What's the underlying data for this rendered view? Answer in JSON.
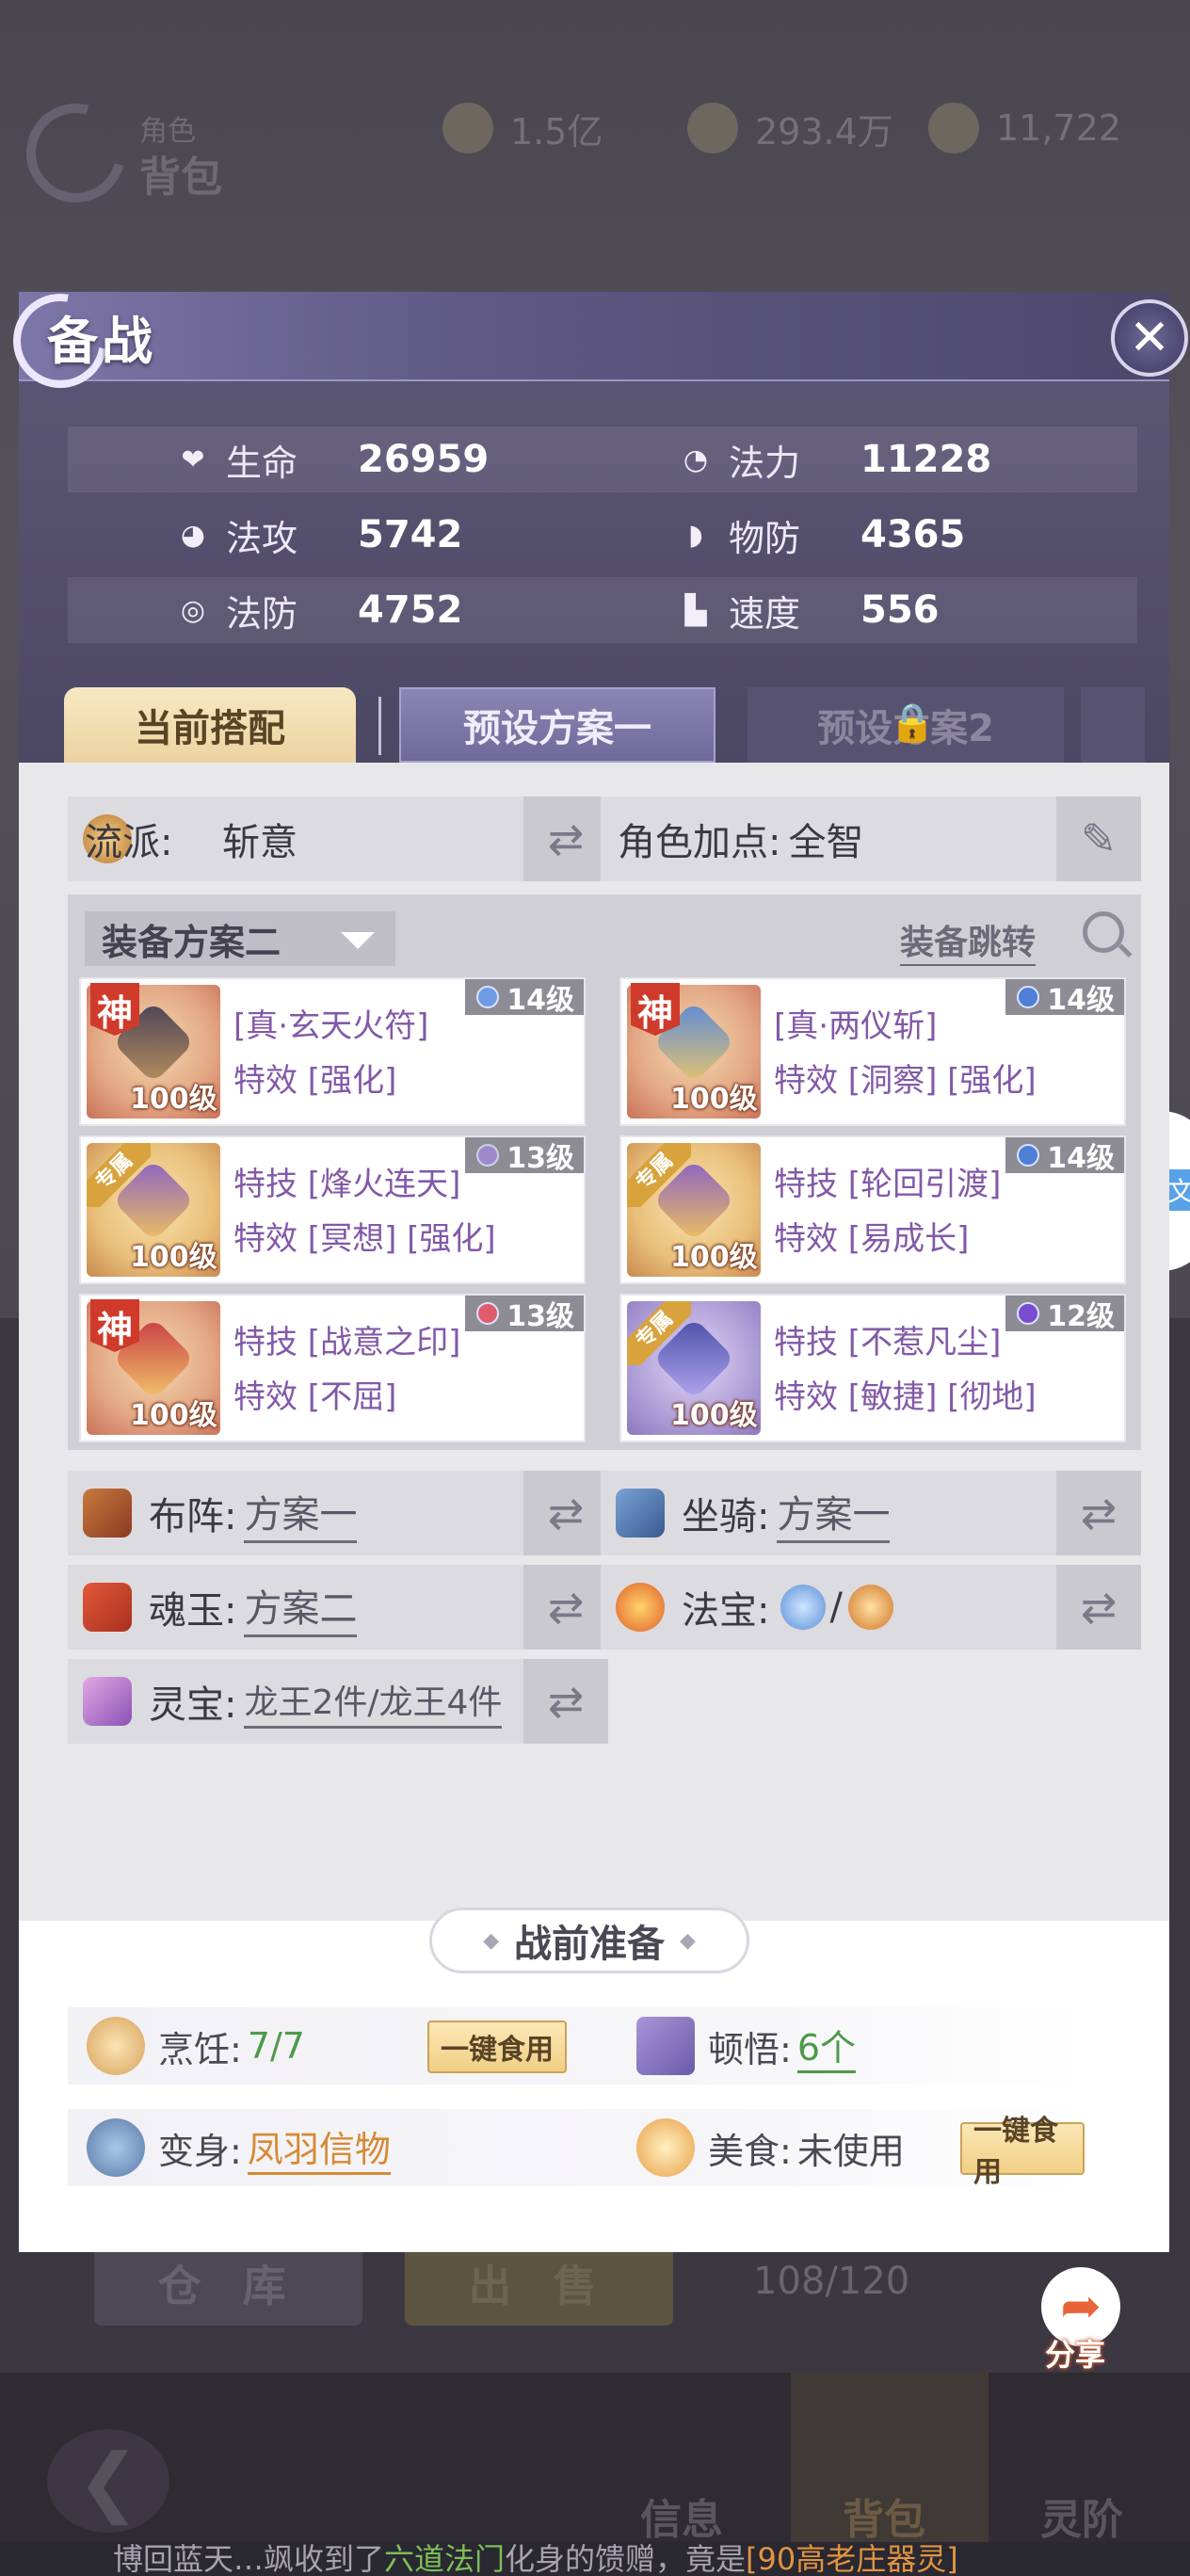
{
  "background": {
    "role_sub": "角色",
    "role_title": "背包",
    "currencies": [
      "1.5亿",
      "293.4万",
      "11,722"
    ],
    "store_button": "仓 库",
    "sell_button": "出 售",
    "bag_count": "108/120",
    "share_label": "分享",
    "nav": {
      "info": "信息",
      "bag": "背包",
      "rank": "灵阶"
    },
    "ticker": {
      "part1": "博回蓝天…飒收到了",
      "hl": "六道法门",
      "part2": "化身的馈赠，竟是",
      "or": "[90高老庄器灵]"
    }
  },
  "dialog": {
    "title": "备战",
    "close": "✕",
    "stats": [
      {
        "icon": "❤",
        "label": "生命",
        "value": "26959"
      },
      {
        "icon": "◔",
        "label": "法力",
        "value": "11228"
      },
      {
        "icon": "◕",
        "label": "法攻",
        "value": "5742"
      },
      {
        "icon": "◗",
        "label": "物防",
        "value": "4365"
      },
      {
        "icon": "◎",
        "label": "法防",
        "value": "4752"
      },
      {
        "icon": "▙",
        "label": "速度",
        "value": "556"
      }
    ],
    "tabs": {
      "current": "当前搭配",
      "preset1": "预设方案一",
      "preset2": "预设方案2"
    },
    "school": {
      "label": "流派:",
      "value": "斩意"
    },
    "points": {
      "label": "角色加点:",
      "value": "全智"
    },
    "equip": {
      "plan": "装备方案二",
      "jump": "装备跳转",
      "items": [
        {
          "tag": "神",
          "lvl": "100级",
          "badge": "14级",
          "line1": "[真·玄天火符]",
          "line2": "特效 [强化]"
        },
        {
          "tag": "神",
          "lvl": "100级",
          "badge": "14级",
          "line1": "[真·两仪斩]",
          "line2": "特效 [洞察] [强化]"
        },
        {
          "tag": "专属",
          "lvl": "100级",
          "badge": "13级",
          "line1": "特技 [烽火连天]",
          "line2": "特效 [冥想] [强化]"
        },
        {
          "tag": "专属",
          "lvl": "100级",
          "badge": "14级",
          "line1": "特技 [轮回引渡]",
          "line2": "特效 [易成长]"
        },
        {
          "tag": "神",
          "lvl": "100级",
          "badge": "13级",
          "line1": "特技 [战意之印]",
          "line2": "特效 [不屈]"
        },
        {
          "tag": "专属",
          "lvl": "100级",
          "badge": "12级",
          "line1": "特技 [不惹凡尘]",
          "line2": "特效 [敏捷] [彻地]"
        }
      ]
    },
    "formation": {
      "label": "布阵:",
      "value": "方案一"
    },
    "mount": {
      "label": "坐骑:",
      "value": "方案一"
    },
    "soul_jade": {
      "label": "魂玉:",
      "value": "方案二"
    },
    "treasure": {
      "label": "法宝:",
      "sep": "/"
    },
    "spirit": {
      "label": "灵宝:",
      "value": "龙王2件/龙王4件"
    },
    "prep": {
      "title": "战前准备",
      "cooking": {
        "label": "烹饪:",
        "value": "7/7",
        "button": "一键食用"
      },
      "insight": {
        "label": "顿悟:",
        "value": "6个"
      },
      "transform": {
        "label": "变身:",
        "value": "凤羽信物"
      },
      "food": {
        "label": "美食:",
        "value": "未使用",
        "button": "一键食用"
      }
    }
  },
  "side_tab_glyph": "文"
}
